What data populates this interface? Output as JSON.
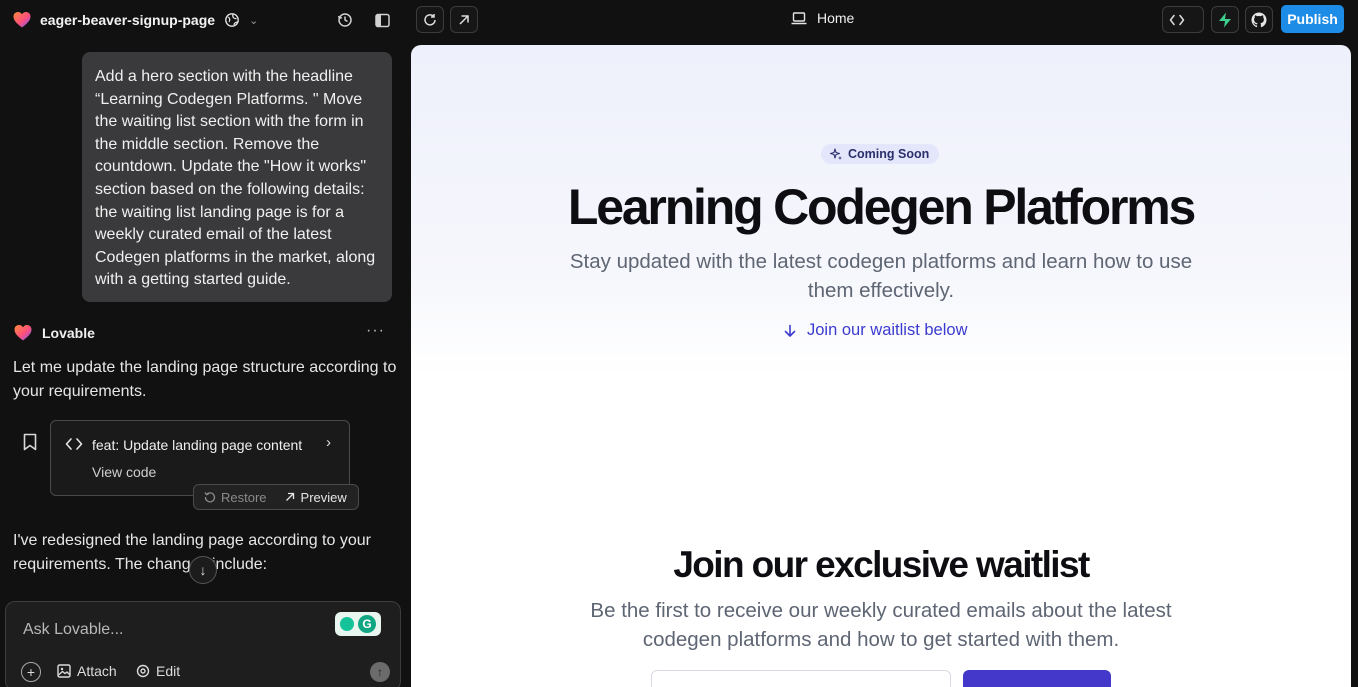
{
  "header": {
    "project_name": "eager-beaver-signup-page",
    "route": "Home",
    "publish_label": "Publish"
  },
  "chat": {
    "user_message": "Add a hero section with the headline “Learning Codegen Platforms. \" Move the waiting list section with the form in the middle section. Remove the countdown. Update the \"How it works\" section based on the following details: the waiting list landing page is for a weekly curated email of the latest Codegen platforms in the market, along with a getting started guide.",
    "assistant_name": "Lovable",
    "assistant_intro": "Let me update the landing page structure according to your requirements.",
    "commit_title": "feat: Update landing page content",
    "view_code_label": "View code",
    "restore_label": "Restore",
    "preview_label": "Preview",
    "assistant_followup": "I've redesigned the landing page according to your requirements. The changes include:"
  },
  "input": {
    "placeholder": "Ask Lovable...",
    "attach_label": "Attach",
    "edit_label": "Edit"
  },
  "site": {
    "badge": "Coming Soon",
    "hero_title": "Learning Codegen Platforms",
    "hero_subtitle": "Stay updated with the latest codegen platforms and learn how to use them effectively.",
    "waitlist_link": "Join our waitlist below",
    "waitlist_title": "Join our exclusive waitlist",
    "waitlist_subtitle": "Be the first to receive our weekly curated emails about the latest codegen platforms and how to get started with them."
  },
  "colors": {
    "publish": "#1c8ce6",
    "accent_link": "#3b3bcf",
    "cta": "#4338ca",
    "supabase": "#3ecf8e"
  }
}
